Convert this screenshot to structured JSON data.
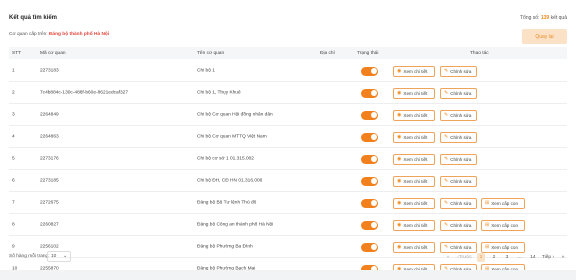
{
  "header": {
    "title": "Kết quả tìm kiếm",
    "total_prefix": "Tổng số:",
    "total_count": "139",
    "total_suffix": "kết quả",
    "parent_label": "Cơ quan cấp trên:",
    "parent_value": "Đảng bộ thành phố Hà Nội",
    "back_label": "Quay lại"
  },
  "table": {
    "columns": [
      "STT",
      "Mã cơ quan",
      "Tên cơ quan",
      "Địa chỉ",
      "Trạng thái",
      "Thao tác"
    ],
    "actions": {
      "view": "Xem chi tiết",
      "edit": "Chỉnh sửa",
      "children": "Xem cấp con"
    },
    "rows": [
      {
        "stt": "1",
        "code": "2273183",
        "name": "Chi bộ 1",
        "address": "",
        "active": true,
        "has_children": false
      },
      {
        "stt": "2",
        "code": "7c4b884c-130c-488f-b60e-8621edcaf327",
        "name": "Chi bộ 1, Thụy Khuê",
        "address": "",
        "active": true,
        "has_children": false
      },
      {
        "stt": "3",
        "code": "2264849",
        "name": "Chi bộ Cơ quan Hội đồng nhân dân",
        "address": "",
        "active": true,
        "has_children": false
      },
      {
        "stt": "4",
        "code": "2264863",
        "name": "Chi bộ Cơ quan MTTQ Việt Nam",
        "address": "",
        "active": true,
        "has_children": false
      },
      {
        "stt": "5",
        "code": "2273176",
        "name": "Chi bộ cơ sở 1 01.315.002",
        "address": "",
        "active": true,
        "has_children": false
      },
      {
        "stt": "6",
        "code": "2273185",
        "name": "Chi bộ ĐH, CĐ HN 01.316.006",
        "address": "",
        "active": true,
        "has_children": false
      },
      {
        "stt": "7",
        "code": "2272675",
        "name": "Đảng bộ Bộ Tư lệnh Thủ đô",
        "address": "",
        "active": true,
        "has_children": true
      },
      {
        "stt": "8",
        "code": "2260827",
        "name": "Đảng bộ Công an thành phố Hà Nội",
        "address": "",
        "active": true,
        "has_children": true
      },
      {
        "stt": "9",
        "code": "2256102",
        "name": "Đảng bộ Phường Ba Đình",
        "address": "",
        "active": true,
        "has_children": true
      },
      {
        "stt": "10",
        "code": "2255870",
        "name": "Đảng bộ Phường Bạch Mai",
        "address": "",
        "active": true,
        "has_children": true
      }
    ]
  },
  "footer": {
    "page_size_label": "Số hàng mỗi trang:",
    "page_size_value": "10",
    "prev_label": "Trước",
    "next_label": "Tiếp",
    "pages": [
      "1",
      "2",
      "3",
      "...",
      "14"
    ]
  },
  "colors": {
    "accent": "#f08a1c",
    "highlight": "#e2443a"
  }
}
